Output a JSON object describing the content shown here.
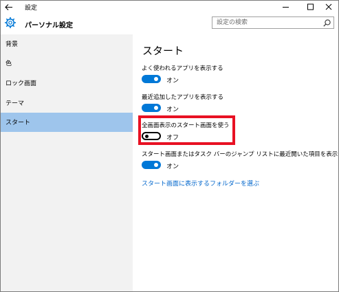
{
  "window": {
    "title": "設定"
  },
  "header": {
    "title": "パーソナル設定",
    "search_placeholder": "設定の検索"
  },
  "sidebar": {
    "items": [
      {
        "label": "背景",
        "selected": false
      },
      {
        "label": "色",
        "selected": false
      },
      {
        "label": "ロック画面",
        "selected": false
      },
      {
        "label": "テーマ",
        "selected": false
      },
      {
        "label": "スタート",
        "selected": true
      }
    ]
  },
  "content": {
    "title": "スタート",
    "settings": [
      {
        "label": "よく使われるアプリを表示する",
        "state": "オン",
        "on": true
      },
      {
        "label": "最近追加したアプリを表示する",
        "state": "オン",
        "on": true
      },
      {
        "label": "全画面表示のスタート画面を使う",
        "state": "オフ",
        "on": false
      },
      {
        "label": "スタート画面またはタスク バーのジャンプ リストに最近開いた項目を表示する",
        "state": "オン",
        "on": true
      }
    ],
    "link": "スタート画面に表示するフォルダーを選ぶ"
  },
  "colors": {
    "accent": "#0078d7",
    "selected_nav": "#9ec5ec",
    "sidebar_bg": "#f2f2f2",
    "highlight": "#e81123",
    "link": "#0066cc"
  }
}
